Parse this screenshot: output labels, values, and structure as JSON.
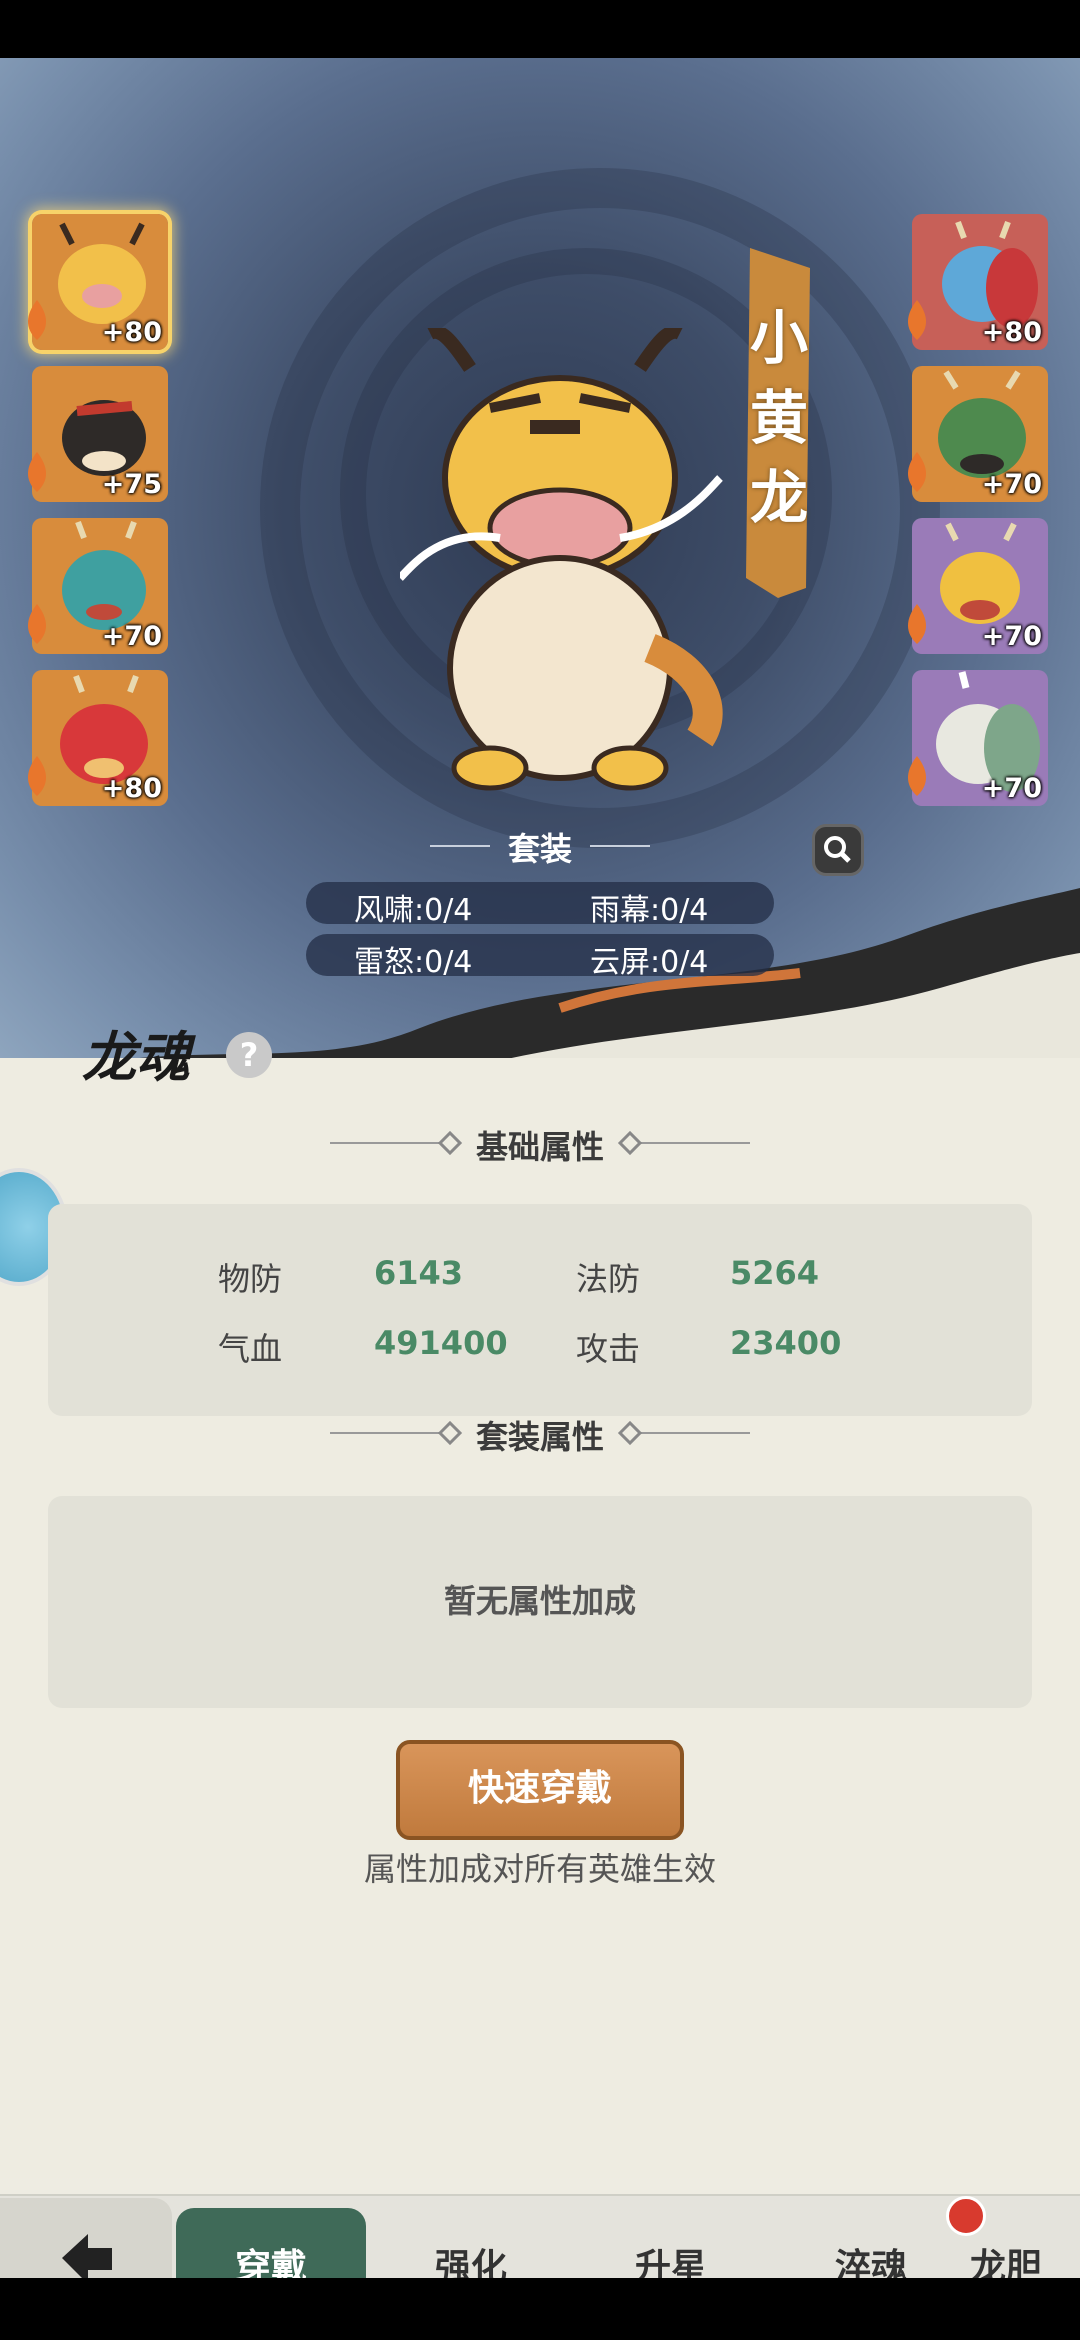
{
  "hero": {
    "name": "小黄龙"
  },
  "left_slots": [
    {
      "plus": "+80",
      "selected": true,
      "bg": "#d88c3c"
    },
    {
      "plus": "+75",
      "bg": "#d88c3c"
    },
    {
      "plus": "+70",
      "bg": "#d88c3c"
    },
    {
      "plus": "+80",
      "bg": "#d88c3c"
    }
  ],
  "right_slots": [
    {
      "plus": "+80",
      "bg": "#c76058"
    },
    {
      "plus": "+70",
      "bg": "#d88c3c"
    },
    {
      "plus": "+70",
      "bg": "#9a7bb8"
    },
    {
      "plus": "+70",
      "bg": "#9a7bb8"
    }
  ],
  "set": {
    "title": "套装",
    "row1_left": "风啸:0/4",
    "row1_right": "雨幕:0/4",
    "row2_left": "雷怒:0/4",
    "row2_right": "云屏:0/4"
  },
  "soul": {
    "title": "龙魂",
    "help": "?"
  },
  "base_attr": {
    "title": "基础属性",
    "pdef_label": "物防",
    "pdef_value": "6143",
    "mdef_label": "法防",
    "mdef_value": "5264",
    "hp_label": "气血",
    "hp_value": "491400",
    "atk_label": "攻击",
    "atk_value": "23400"
  },
  "set_attr": {
    "title": "套装属性",
    "empty": "暂无属性加成"
  },
  "quick_equip": "快速穿戴",
  "hint": "属性加成对所有英雄生效",
  "tabs": [
    "穿戴",
    "强化",
    "升星",
    "淬魂",
    "龙胆"
  ],
  "colors": {
    "accent_green": "#4a8a66",
    "button_orange": "#c98446",
    "tab_active": "#3f6a58"
  }
}
